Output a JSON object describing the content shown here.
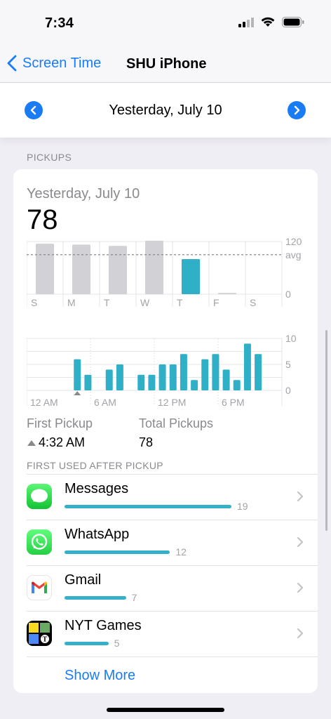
{
  "status_bar": {
    "time": "7:34"
  },
  "nav": {
    "back_label": "Screen Time",
    "title": "SHU iPhone"
  },
  "date_picker": {
    "label": "Yesterday, July 10"
  },
  "section": {
    "header": "PICKUPS"
  },
  "card": {
    "subtitle": "Yesterday, July 10",
    "value": "78"
  },
  "weekly_chart": {
    "type": "bar",
    "categories": [
      "S",
      "M",
      "T",
      "W",
      "T",
      "F",
      "S"
    ],
    "values": [
      115,
      113,
      110,
      122,
      80,
      3,
      0
    ],
    "highlight_index": 4,
    "avg": 90,
    "ylim": [
      0,
      120
    ],
    "y_labels": [
      "120",
      "avg",
      "0"
    ],
    "colors": {
      "highlight": "#30b0c7",
      "normal": "#d1d1d6",
      "grid": "#e5e5ea"
    }
  },
  "hourly_chart": {
    "type": "bar",
    "hours": [
      0,
      1,
      2,
      3,
      4,
      5,
      6,
      7,
      8,
      9,
      10,
      11,
      12,
      13,
      14,
      15,
      15.5,
      16,
      17,
      18,
      19,
      20,
      21,
      22,
      23
    ],
    "values": [
      0,
      0,
      0,
      0,
      6,
      3,
      0,
      4,
      5,
      0,
      3,
      3,
      5,
      5,
      7,
      2,
      0,
      6,
      7,
      4,
      2,
      9,
      7,
      0,
      0
    ],
    "ylim": [
      0,
      10
    ],
    "y_labels": [
      "10",
      "5",
      "0"
    ],
    "x_labels": [
      "12 AM",
      "6 AM",
      "12 PM",
      "6 PM"
    ],
    "first_pickup_marker_hour": 4,
    "colors": {
      "bar": "#30b0c7",
      "grid": "#e5e5ea"
    }
  },
  "stats": {
    "first_pickup_label": "First Pickup",
    "first_pickup_value": "4:32 AM",
    "total_pickups_label": "Total Pickups",
    "total_pickups_value": "78"
  },
  "first_used": {
    "header": "FIRST USED AFTER PICKUP",
    "apps": [
      {
        "name": "Messages",
        "count": "19",
        "value": 19,
        "icon": "messages-icon"
      },
      {
        "name": "WhatsApp",
        "count": "12",
        "value": 12,
        "icon": "whatsapp-icon"
      },
      {
        "name": "Gmail",
        "count": "7",
        "value": 7,
        "icon": "gmail-icon"
      },
      {
        "name": "NYT Games",
        "count": "5",
        "value": 5,
        "icon": "nyt-games-icon"
      }
    ],
    "show_more": "Show More"
  }
}
